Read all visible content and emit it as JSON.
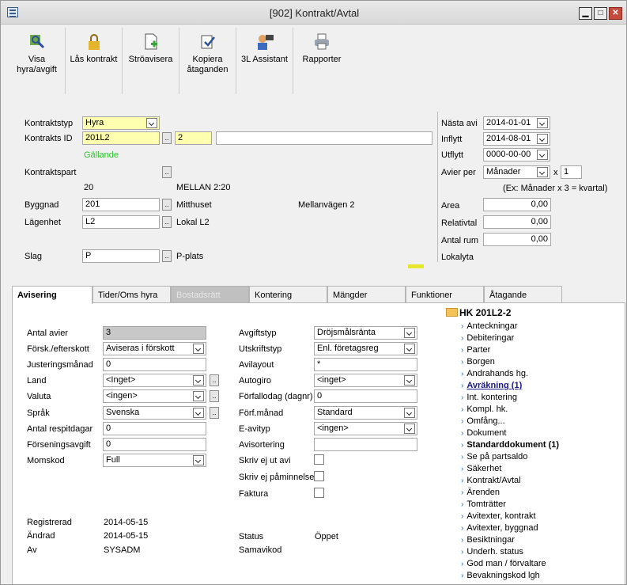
{
  "window": {
    "title": "[902]  Kontrakt/Avtal"
  },
  "toolbar": [
    {
      "label": "Visa hyra/avgift",
      "icon": "view-rent-icon"
    },
    {
      "label": "Lås kontrakt",
      "icon": "lock-icon"
    },
    {
      "label": "Ströavisera",
      "icon": "document-add-icon"
    },
    {
      "label": "Kopiera åtaganden",
      "icon": "copy-check-icon"
    },
    {
      "label": "3L Assistant",
      "icon": "assistant-icon"
    },
    {
      "label": "Rapporter",
      "icon": "printer-icon"
    }
  ],
  "form": {
    "kontraktstyp_label": "Kontraktstyp",
    "kontraktstyp": "Hyra",
    "kontrakts_id_label": "Kontrakts ID",
    "kontrakts_id": "201L2",
    "kontrakts_id_suffix": "2",
    "kontrakts_id_desc": "",
    "status_text": "Gällande",
    "kontraktspart_label": "Kontraktspart",
    "kontraktspart_nr": "20",
    "kontraktspart_name": "MELLAN 2:20",
    "byggnad_label": "Byggnad",
    "byggnad": "201",
    "byggnad_name": "Mitthuset",
    "byggnad_address": "Mellanvägen 2",
    "lagenhet_label": "Lägenhet",
    "lagenhet": "L2",
    "lagenhet_name": "Lokal L2",
    "slag_label": "Slag",
    "slag": "P",
    "slag_name": "P-plats"
  },
  "right": {
    "nasta_avi_label": "Nästa avi",
    "nasta_avi": "2014-01-01",
    "inflytt_label": "Inflytt",
    "inflytt": "2014-08-01",
    "utflytt_label": "Utflytt",
    "utflytt": "0000-00-00",
    "avier_per_label": "Avier per",
    "avier_per": "Månader",
    "x_label": "x",
    "avier_multiplier": "1",
    "hint": "(Ex: Månader x 3 = kvartal)",
    "area_label": "Area",
    "area": "0,00",
    "relativtal_label": "Relativtal",
    "relativtal": "0,00",
    "antal_rum_label": "Antal rum",
    "antal_rum": "0,00",
    "lokalyta_label": "Lokalyta"
  },
  "tabs": [
    {
      "label": "Avisering",
      "state": "active"
    },
    {
      "label": "Tider/Oms hyra",
      "state": "normal"
    },
    {
      "label": "Bostadsrätt",
      "state": "disabled"
    },
    {
      "label": "Kontering",
      "state": "normal"
    },
    {
      "label": "Mängder",
      "state": "normal"
    },
    {
      "label": "Funktioner",
      "state": "normal"
    },
    {
      "label": "Åtagande",
      "state": "normal"
    }
  ],
  "avisering": {
    "antal_avier_label": "Antal avier",
    "antal_avier": "3",
    "forsk_label": "Försk./efterskott",
    "forsk": "Aviseras i förskott",
    "justering_label": "Justeringsmånad",
    "justering": "0",
    "land_label": "Land",
    "land": "<Inget>",
    "valuta_label": "Valuta",
    "valuta": "<ingen>",
    "sprak_label": "Språk",
    "sprak": "Svenska",
    "respit_label": "Antal respitdagar",
    "respit": "0",
    "forsening_label": "Förseningsavgift",
    "forsening": "0",
    "momskod_label": "Momskod",
    "momskod": "Full",
    "avgiftstyp_label": "Avgiftstyp",
    "avgiftstyp": "Dröjsmålsränta",
    "utskriftstyp_label": "Utskriftstyp",
    "utskriftstyp": "Enl. företagsreg",
    "avilayout_label": "Avilayout",
    "avilayout": "*",
    "autogiro_label": "Autogiro",
    "autogiro": "<inget>",
    "forfallodag_label": "Förfallodag (dagnr)",
    "forfallodag": "0",
    "forf_manad_label": "Förf.månad",
    "forf_manad": "Standard",
    "e_avityp_label": "E-avityp",
    "e_avityp": "<ingen>",
    "avisortering_label": "Avisortering",
    "avisortering": "",
    "skriv_ej_ut_label": "Skriv ej ut avi",
    "skriv_ej_pam_label": "Skriv ej påminnelse",
    "faktura_label": "Faktura",
    "registrerad_label": "Registrerad",
    "registrerad": "2014-05-15",
    "andrad_label": "Ändrad",
    "andrad": "2014-05-15",
    "av_label": "Av",
    "av": "SYSADM",
    "status_label": "Status",
    "status": "Öppet",
    "samavikod_label": "Samavikod",
    "samavikod": ""
  },
  "tree": {
    "root": "HK 201L2-2",
    "items": [
      {
        "label": "Anteckningar"
      },
      {
        "label": "Debiteringar"
      },
      {
        "label": "Parter"
      },
      {
        "label": "Borgen"
      },
      {
        "label": "Andrahands hg."
      },
      {
        "label": "Avräkning (1)",
        "style": "selected"
      },
      {
        "label": "Int. kontering"
      },
      {
        "label": "Kompl. hk."
      },
      {
        "label": "Omfång..."
      },
      {
        "label": "Dokument"
      },
      {
        "label": "Standarddokument (1)",
        "style": "bold"
      },
      {
        "label": "Se på partsaldo"
      },
      {
        "label": "Säkerhet"
      },
      {
        "label": "Kontrakt/Avtal"
      },
      {
        "label": "Ärenden"
      },
      {
        "label": "Tomträtter"
      },
      {
        "label": "Avitexter, kontrakt"
      },
      {
        "label": "Avitexter, byggnad"
      },
      {
        "label": "Besiktningar"
      },
      {
        "label": "Underh. status"
      },
      {
        "label": "God man / förvaltare"
      },
      {
        "label": "Bevakningskod lgh"
      }
    ]
  }
}
